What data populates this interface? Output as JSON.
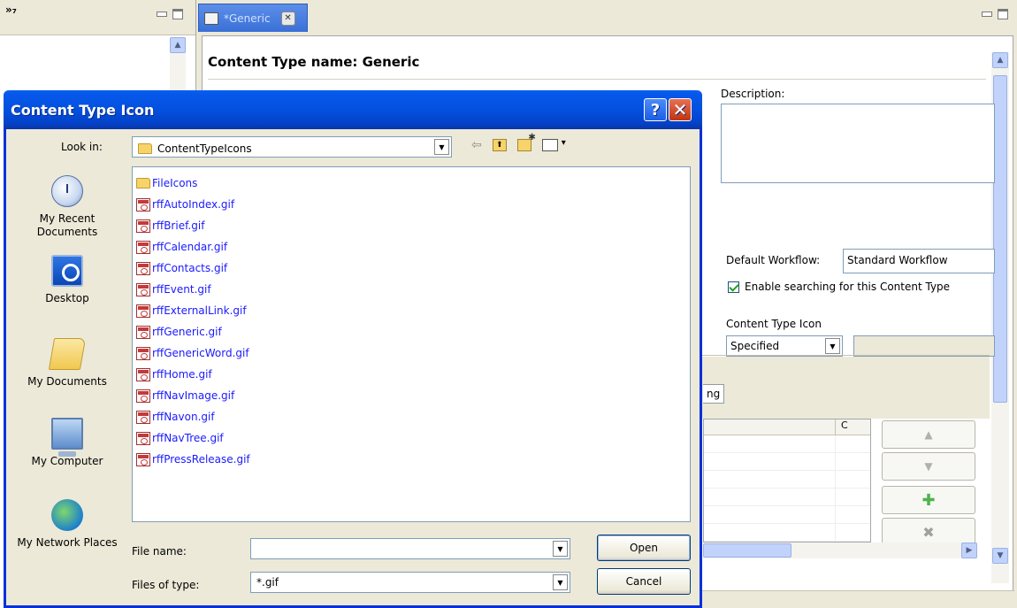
{
  "window": {
    "chevron": "»₇"
  },
  "editor": {
    "tab_label": "*Generic",
    "tab_close": "✕",
    "content_type_title": "Content Type name: Generic",
    "description_label": "Description:",
    "description_value": "",
    "default_workflow_label": "Default Workflow:",
    "default_workflow_value": "Standard Workflow",
    "enable_search_label": "Enable searching for this Content Type",
    "enable_search_checked": true,
    "content_type_icon_label": "Content Type Icon",
    "content_type_icon_select": "Specified",
    "content_type_icon_path": "",
    "tab_fragment": "ng",
    "grid_column_c": "C"
  },
  "dialog": {
    "title": "Content Type Icon",
    "help_button": "?",
    "close_button": "✕",
    "look_in_label": "Look in:",
    "look_in_value": "ContentTypeIcons",
    "places": [
      {
        "label": "My Recent Documents",
        "icon": "recent-documents-icon"
      },
      {
        "label": "Desktop",
        "icon": "desktop-icon"
      },
      {
        "label": "My Documents",
        "icon": "my-documents-icon"
      },
      {
        "label": "My Computer",
        "icon": "my-computer-icon"
      },
      {
        "label": "My Network Places",
        "icon": "network-places-icon"
      }
    ],
    "files": [
      {
        "name": "FileIcons",
        "type": "folder"
      },
      {
        "name": "rffAutoIndex.gif",
        "type": "gif"
      },
      {
        "name": "rffBrief.gif",
        "type": "gif"
      },
      {
        "name": "rffCalendar.gif",
        "type": "gif"
      },
      {
        "name": "rffContacts.gif",
        "type": "gif"
      },
      {
        "name": "rffEvent.gif",
        "type": "gif"
      },
      {
        "name": "rffExternalLink.gif",
        "type": "gif"
      },
      {
        "name": "rffGeneric.gif",
        "type": "gif"
      },
      {
        "name": "rffGenericWord.gif",
        "type": "gif"
      },
      {
        "name": "rffHome.gif",
        "type": "gif"
      },
      {
        "name": "rffNavImage.gif",
        "type": "gif"
      },
      {
        "name": "rffNavon.gif",
        "type": "gif"
      },
      {
        "name": "rffNavTree.gif",
        "type": "gif"
      },
      {
        "name": "rffPressRelease.gif",
        "type": "gif"
      }
    ],
    "file_name_label": "File name:",
    "file_name_value": "",
    "files_of_type_label": "Files of type:",
    "files_of_type_value": "*.gif",
    "open_button": "Open",
    "cancel_button": "Cancel"
  },
  "colors": {
    "title_bar": "#0450df",
    "file_link": "#1a1aff",
    "close_button": "#c2340f"
  }
}
